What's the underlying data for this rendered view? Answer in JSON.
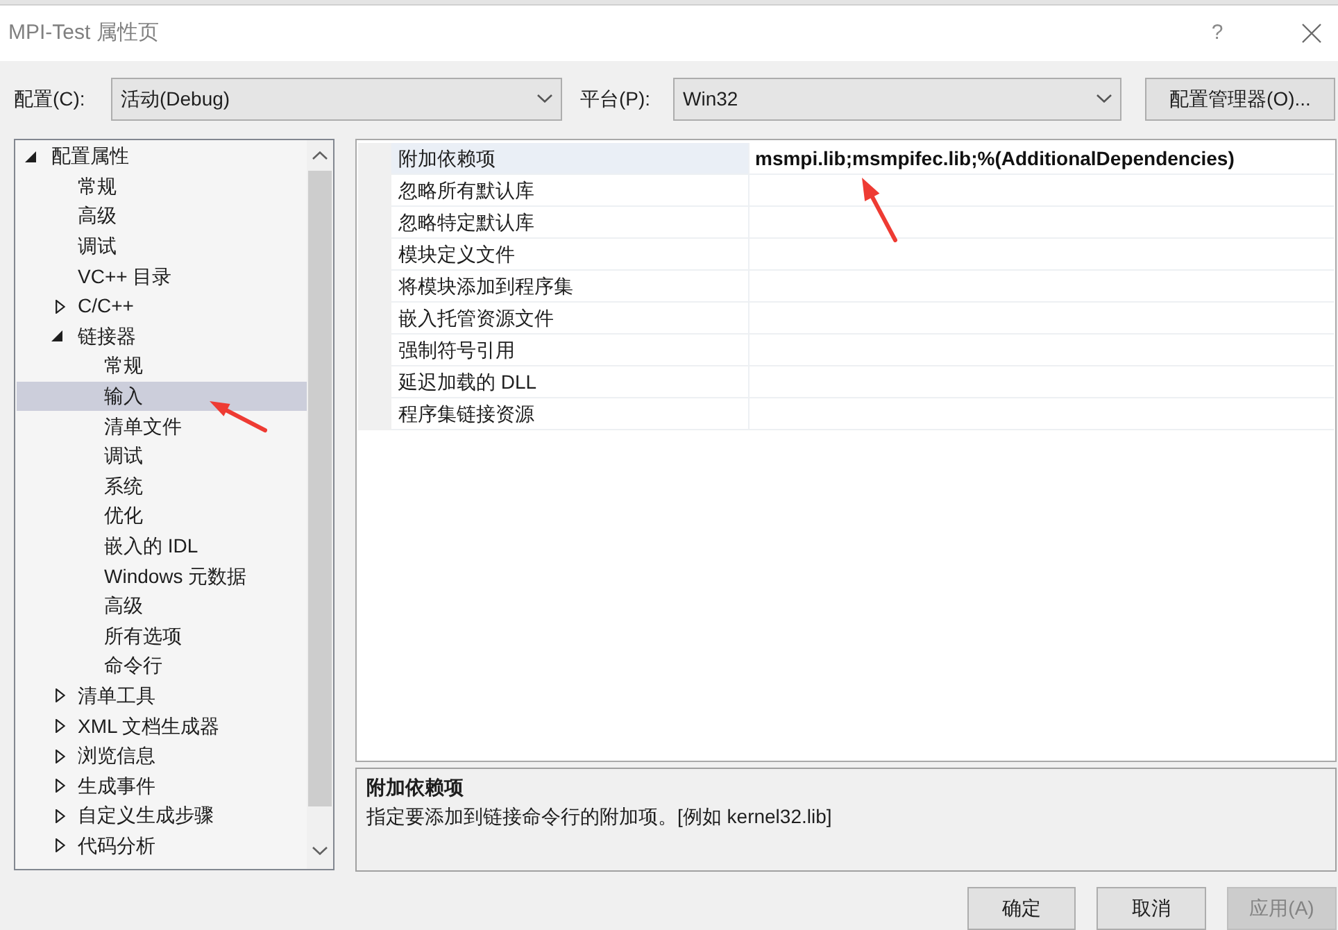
{
  "window": {
    "title": "MPI-Test 属性页",
    "help_button": "?"
  },
  "toolbar": {
    "configuration": {
      "label": "配置(C):",
      "value": "活动(Debug)"
    },
    "platform": {
      "label": "平台(P):",
      "value": "Win32"
    },
    "manager_button": "配置管理器(O)..."
  },
  "tree": {
    "items": [
      {
        "label": "配置属性",
        "expanded": true,
        "selected": false,
        "children": [
          {
            "label": "常规",
            "selected": false
          },
          {
            "label": "高级",
            "selected": false
          },
          {
            "label": "调试",
            "selected": false
          },
          {
            "label": "VC++ 目录",
            "selected": false
          },
          {
            "label": "C/C++",
            "expanded": false,
            "selected": false
          },
          {
            "label": "链接器",
            "expanded": true,
            "selected": false,
            "children": [
              {
                "label": "常规",
                "selected": false
              },
              {
                "label": "输入",
                "selected": true
              },
              {
                "label": "清单文件",
                "selected": false
              },
              {
                "label": "调试",
                "selected": false
              },
              {
                "label": "系统",
                "selected": false
              },
              {
                "label": "优化",
                "selected": false
              },
              {
                "label": "嵌入的 IDL",
                "selected": false
              },
              {
                "label": "Windows 元数据",
                "selected": false
              },
              {
                "label": "高级",
                "selected": false
              },
              {
                "label": "所有选项",
                "selected": false
              },
              {
                "label": "命令行",
                "selected": false
              }
            ]
          },
          {
            "label": "清单工具",
            "expanded": false,
            "selected": false
          },
          {
            "label": "XML 文档生成器",
            "expanded": false,
            "selected": false
          },
          {
            "label": "浏览信息",
            "expanded": false,
            "selected": false
          },
          {
            "label": "生成事件",
            "expanded": false,
            "selected": false
          },
          {
            "label": "自定义生成步骤",
            "expanded": false,
            "selected": false
          },
          {
            "label": "代码分析",
            "expanded": false,
            "selected": false
          }
        ]
      }
    ]
  },
  "property_grid": {
    "rows": [
      {
        "name": "附加依赖项",
        "value": "msmpi.lib;msmpifec.lib;%(AdditionalDependencies)",
        "selected": true
      },
      {
        "name": "忽略所有默认库",
        "selected": false
      },
      {
        "name": "忽略特定默认库",
        "selected": false
      },
      {
        "name": "模块定义文件",
        "selected": false
      },
      {
        "name": "将模块添加到程序集",
        "selected": false
      },
      {
        "name": "嵌入托管资源文件",
        "selected": false
      },
      {
        "name": "强制符号引用",
        "selected": false
      },
      {
        "name": "延迟加载的 DLL",
        "selected": false
      },
      {
        "name": "程序集链接资源",
        "selected": false
      }
    ]
  },
  "description": {
    "title": "附加依赖项",
    "text": "指定要添加到链接命令行的附加项。[例如 kernel32.lib]"
  },
  "buttons": [
    {
      "label": "确定",
      "disabled": false
    },
    {
      "label": "取消",
      "disabled": false
    },
    {
      "label": "应用(A)",
      "disabled": true
    }
  ]
}
